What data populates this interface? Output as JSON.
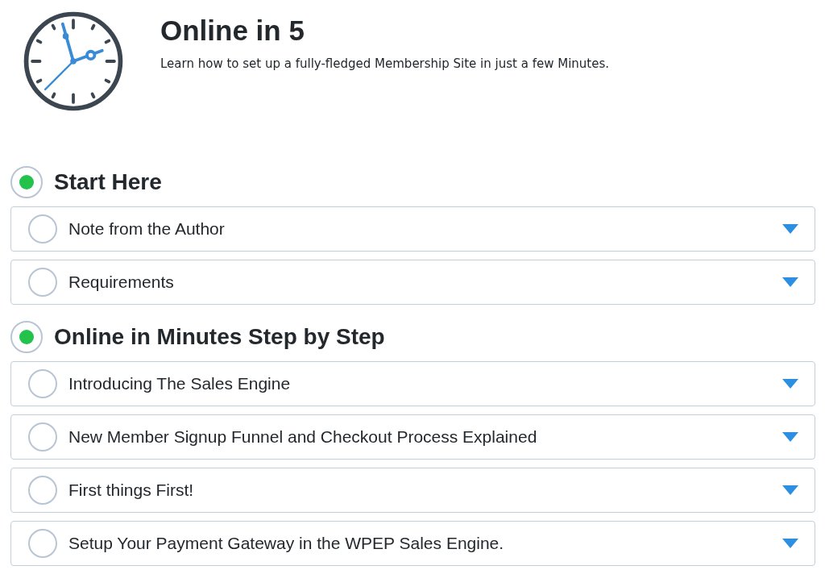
{
  "course": {
    "title": "Online in 5",
    "subtitle": "Learn how to set up a fully-fledged Membership Site in just a few Minutes."
  },
  "sections": [
    {
      "title": "Start Here",
      "started": true,
      "lessons": [
        {
          "title": "Note from the Author",
          "completed": false,
          "expanded": false
        },
        {
          "title": "Requirements",
          "completed": false,
          "expanded": false
        }
      ]
    },
    {
      "title": "Online in Minutes Step by Step",
      "started": true,
      "lessons": [
        {
          "title": "Introducing The Sales Engine",
          "completed": false,
          "expanded": false
        },
        {
          "title": "New Member Signup Funnel and Checkout Process Explained",
          "completed": false,
          "expanded": false
        },
        {
          "title": "First things First!",
          "completed": false,
          "expanded": false
        },
        {
          "title": "Setup Your Payment Gateway in the WPEP Sales Engine.",
          "completed": false,
          "expanded": false
        }
      ]
    }
  ]
}
